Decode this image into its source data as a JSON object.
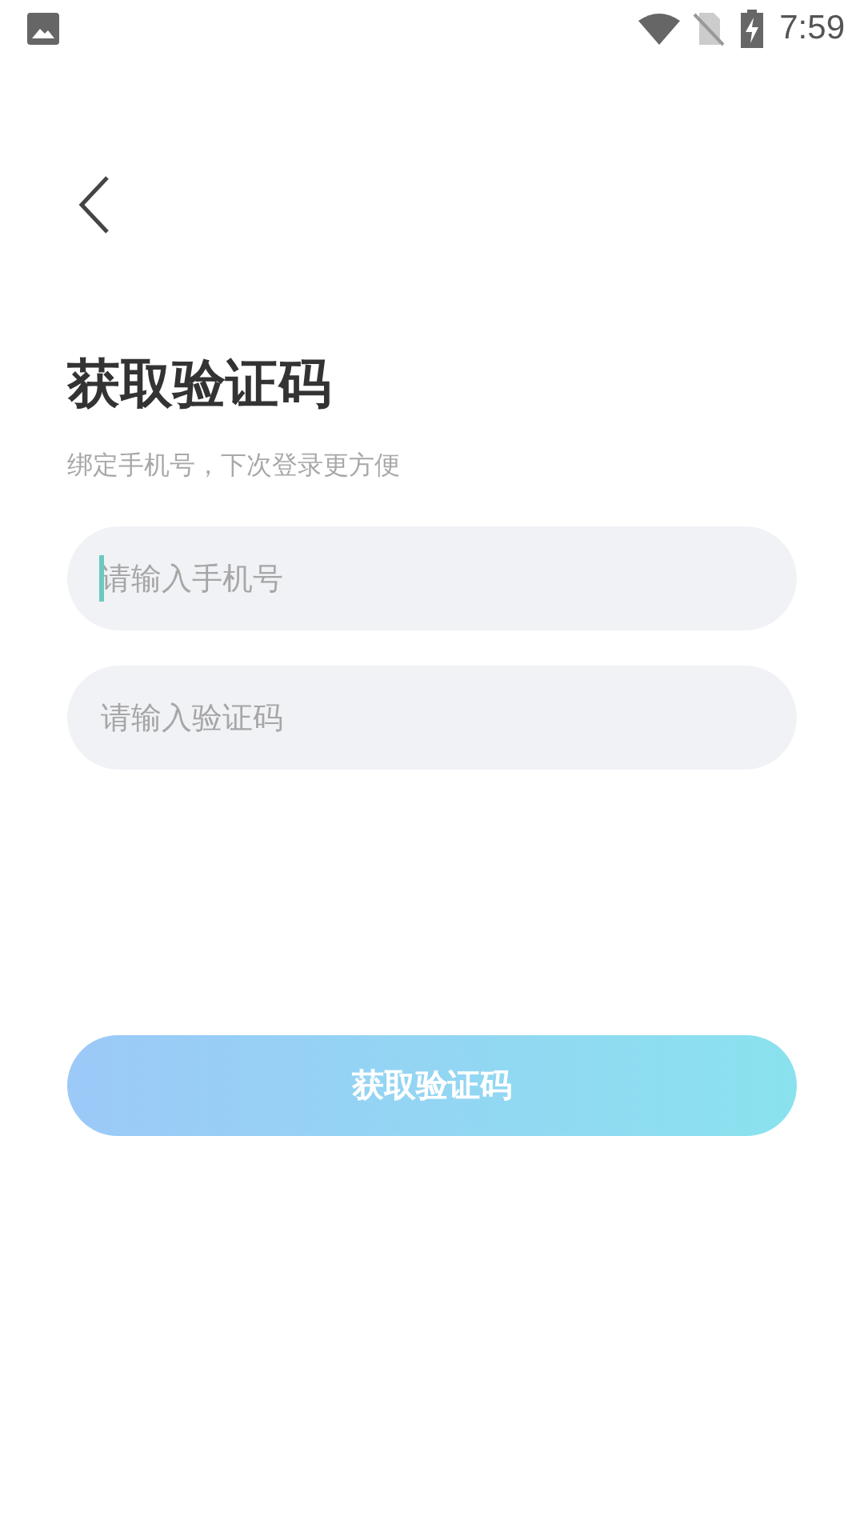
{
  "status_bar": {
    "time": "7:59"
  },
  "title": "获取验证码",
  "subtitle": "绑定手机号，下次登录更方便",
  "fields": [
    {
      "placeholder": "请输入手机号",
      "focused": true
    },
    {
      "placeholder": "请输入验证码",
      "focused": false
    }
  ],
  "submit_button": {
    "label": "获取验证码",
    "disabled": true
  }
}
